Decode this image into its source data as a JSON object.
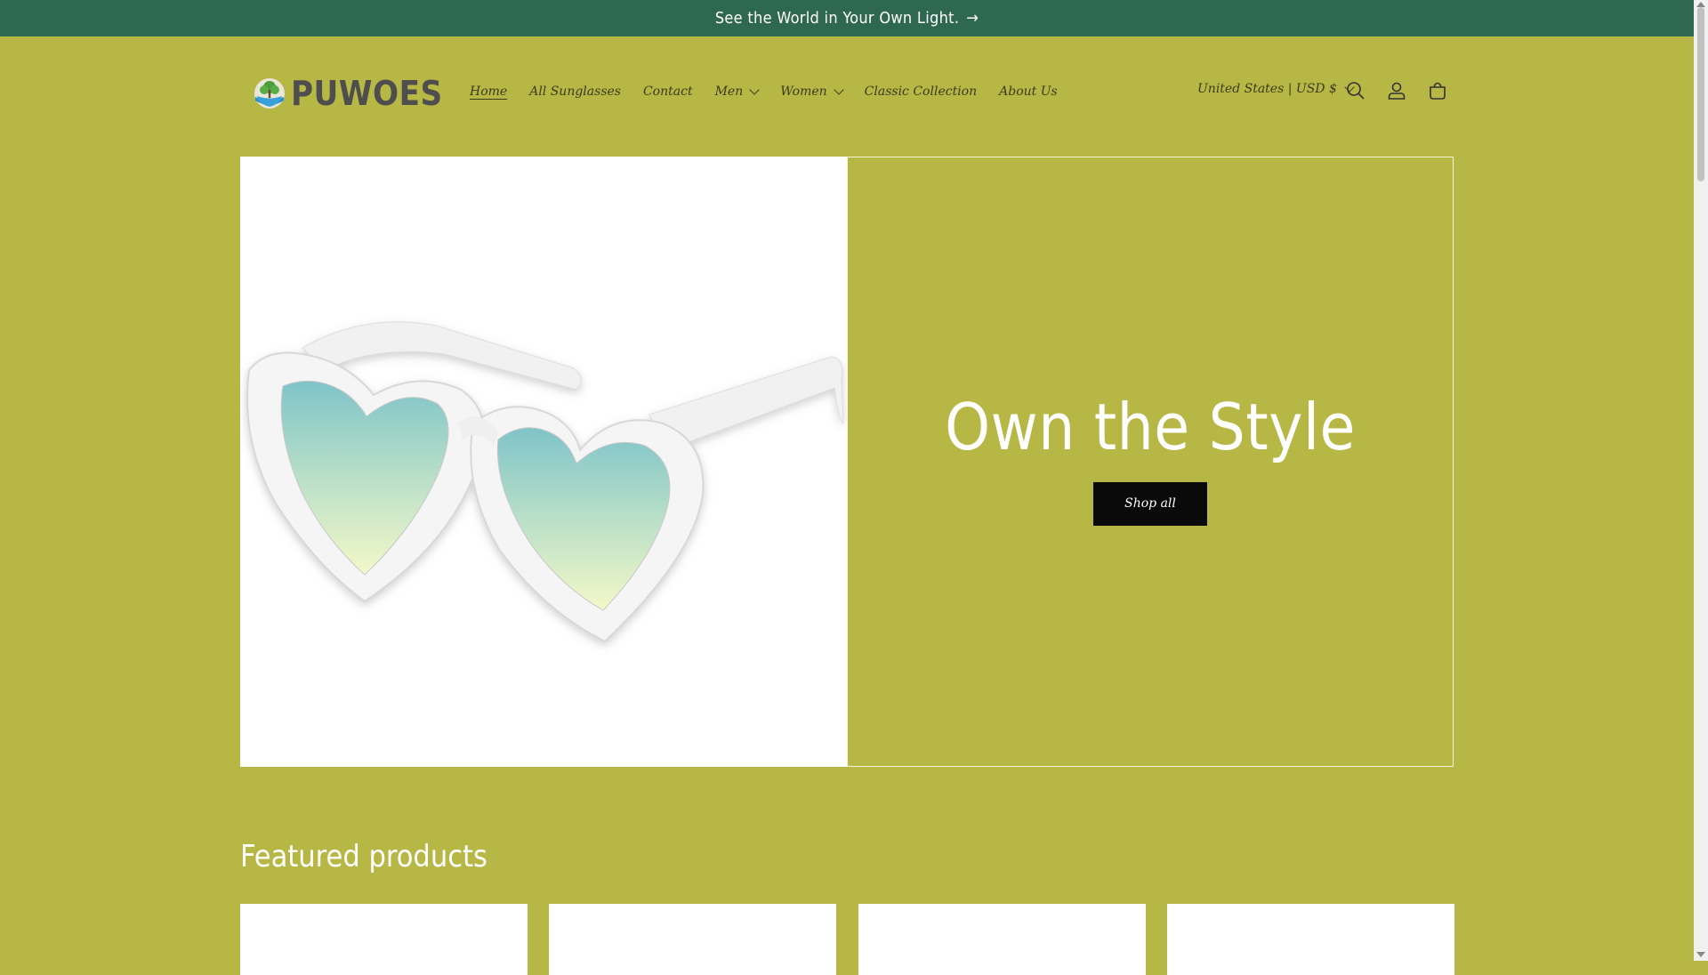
{
  "announcement": {
    "text": "See the World in Your Own Light.",
    "arrow": "→"
  },
  "logo": {
    "text": "PUWOES"
  },
  "nav": {
    "items": [
      {
        "label": "Home",
        "active": true,
        "dropdown": false
      },
      {
        "label": "All Sunglasses",
        "dropdown": false
      },
      {
        "label": "Contact",
        "dropdown": false
      },
      {
        "label": "Men",
        "dropdown": true
      },
      {
        "label": "Women",
        "dropdown": true
      },
      {
        "label": "Classic Collection",
        "dropdown": false
      },
      {
        "label": "About Us",
        "dropdown": false
      }
    ]
  },
  "header": {
    "currency": "United States | USD $",
    "icons": [
      "search-icon",
      "account-icon",
      "cart-icon"
    ]
  },
  "hero": {
    "heading": "Own the Style",
    "button": "Shop all",
    "image": "white-heart-sunglasses"
  },
  "featured": {
    "title": "Featured products",
    "card_count": 4
  },
  "colors": {
    "background": "#b7b745",
    "announcement_bar": "#2f6851",
    "button": "#0a0a0a"
  }
}
